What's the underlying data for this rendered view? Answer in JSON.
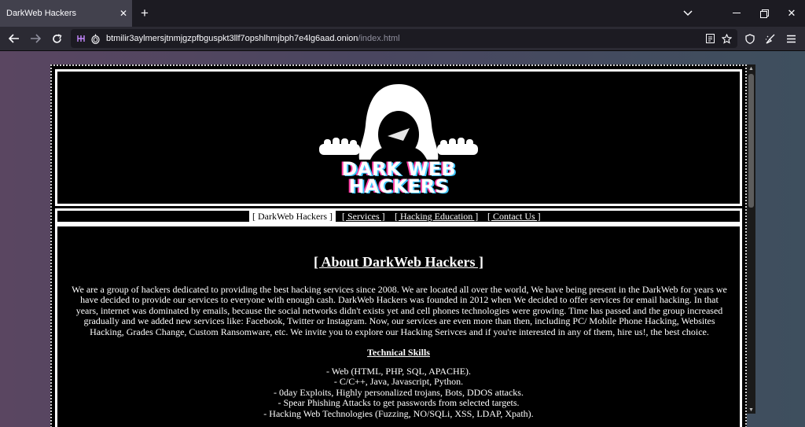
{
  "browser": {
    "tab_title": "DarkWeb Hackers",
    "url_host": "btmilir3aylmersjtnmjgzpfbguspkt3llf7opshlhmjbph7e4lg6aad.onion",
    "url_path": "/index.html"
  },
  "logo": {
    "line1": "DARK WEB",
    "line2": "HACKERS"
  },
  "menu": {
    "items": [
      {
        "label": "[ DarkWeb Hackers ]",
        "active": true
      },
      {
        "label": "[ Services ]"
      },
      {
        "label": "[ Hacking Education ]"
      },
      {
        "label": "[ Contact Us ]"
      }
    ]
  },
  "about": {
    "title": "[ About DarkWeb Hackers ]",
    "paragraph": "We are a group of hackers dedicated to providing the best hacking services since 2008. We are located all over the world, We have being present in the DarkWeb for years we have decided to provide our services to everyone with enough cash. DarkWeb Hackers was founded in 2012 when We decided to offer services for email hacking. In that years, internet was dominated by emails, because the social networks didn't exists yet and cell phones technologies were growing. Time has passed and the group increased gradually and we added new services like: Facebook, Twitter or Instagram. Now, our services are even more than then, including PC/ Mobile Phone Hacking, Websites Hacking, Grades Change, Custom Ransomware, etc. We invite you to explore our Hacking Serivces and if you're interested in any of them, hire us!, the best choice.",
    "skills_title": "Technical Skills",
    "skills": [
      "- Web (HTML, PHP, SQL, APACHE).",
      "- C/C++, Java, Javascript, Python.",
      "- 0day Exploits, Highly personalized trojans, Bots, DDOS attacks.",
      "- Spear Phishing Attacks to get passwords from selected targets.",
      "- Hacking Web Technologies (Fuzzing, NO/SQLi, XSS, LDAP, Xpath)."
    ]
  },
  "colors": {
    "page_bg": "#000000",
    "text": "#ffffff",
    "logo_accent": "#ff3ea5",
    "logo_accent2": "#3ec5ff"
  }
}
